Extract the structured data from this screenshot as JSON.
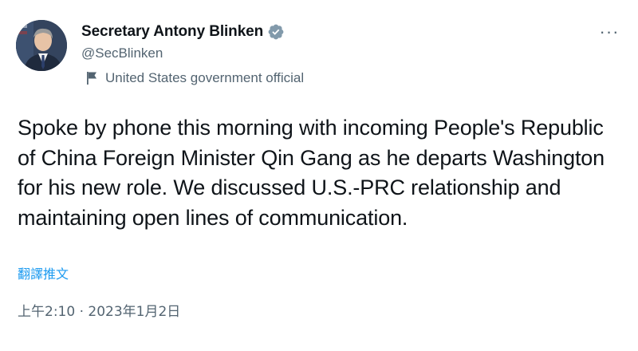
{
  "author": {
    "display_name": "Secretary Antony Blinken",
    "handle": "@SecBlinken",
    "verified": true,
    "gov_label": "United States government official",
    "avatar_icon": "profile-photo"
  },
  "menu": {
    "more_icon": "more-horizontal-icon",
    "more_glyph": "···"
  },
  "tweet": {
    "text": "Spoke by phone this morning with incoming People's Republic of China Foreign Minister Qin Gang as he departs Washington for his new role. We discussed U.S.-PRC relationship and maintaining open lines of communication.",
    "translate_label": "翻譯推文",
    "timestamp": "上午2:10 · 2023年1月2日"
  },
  "colors": {
    "text_primary": "#0f1419",
    "text_secondary": "#536471",
    "link": "#1d9bf0",
    "verified_badge": "#829aab"
  }
}
